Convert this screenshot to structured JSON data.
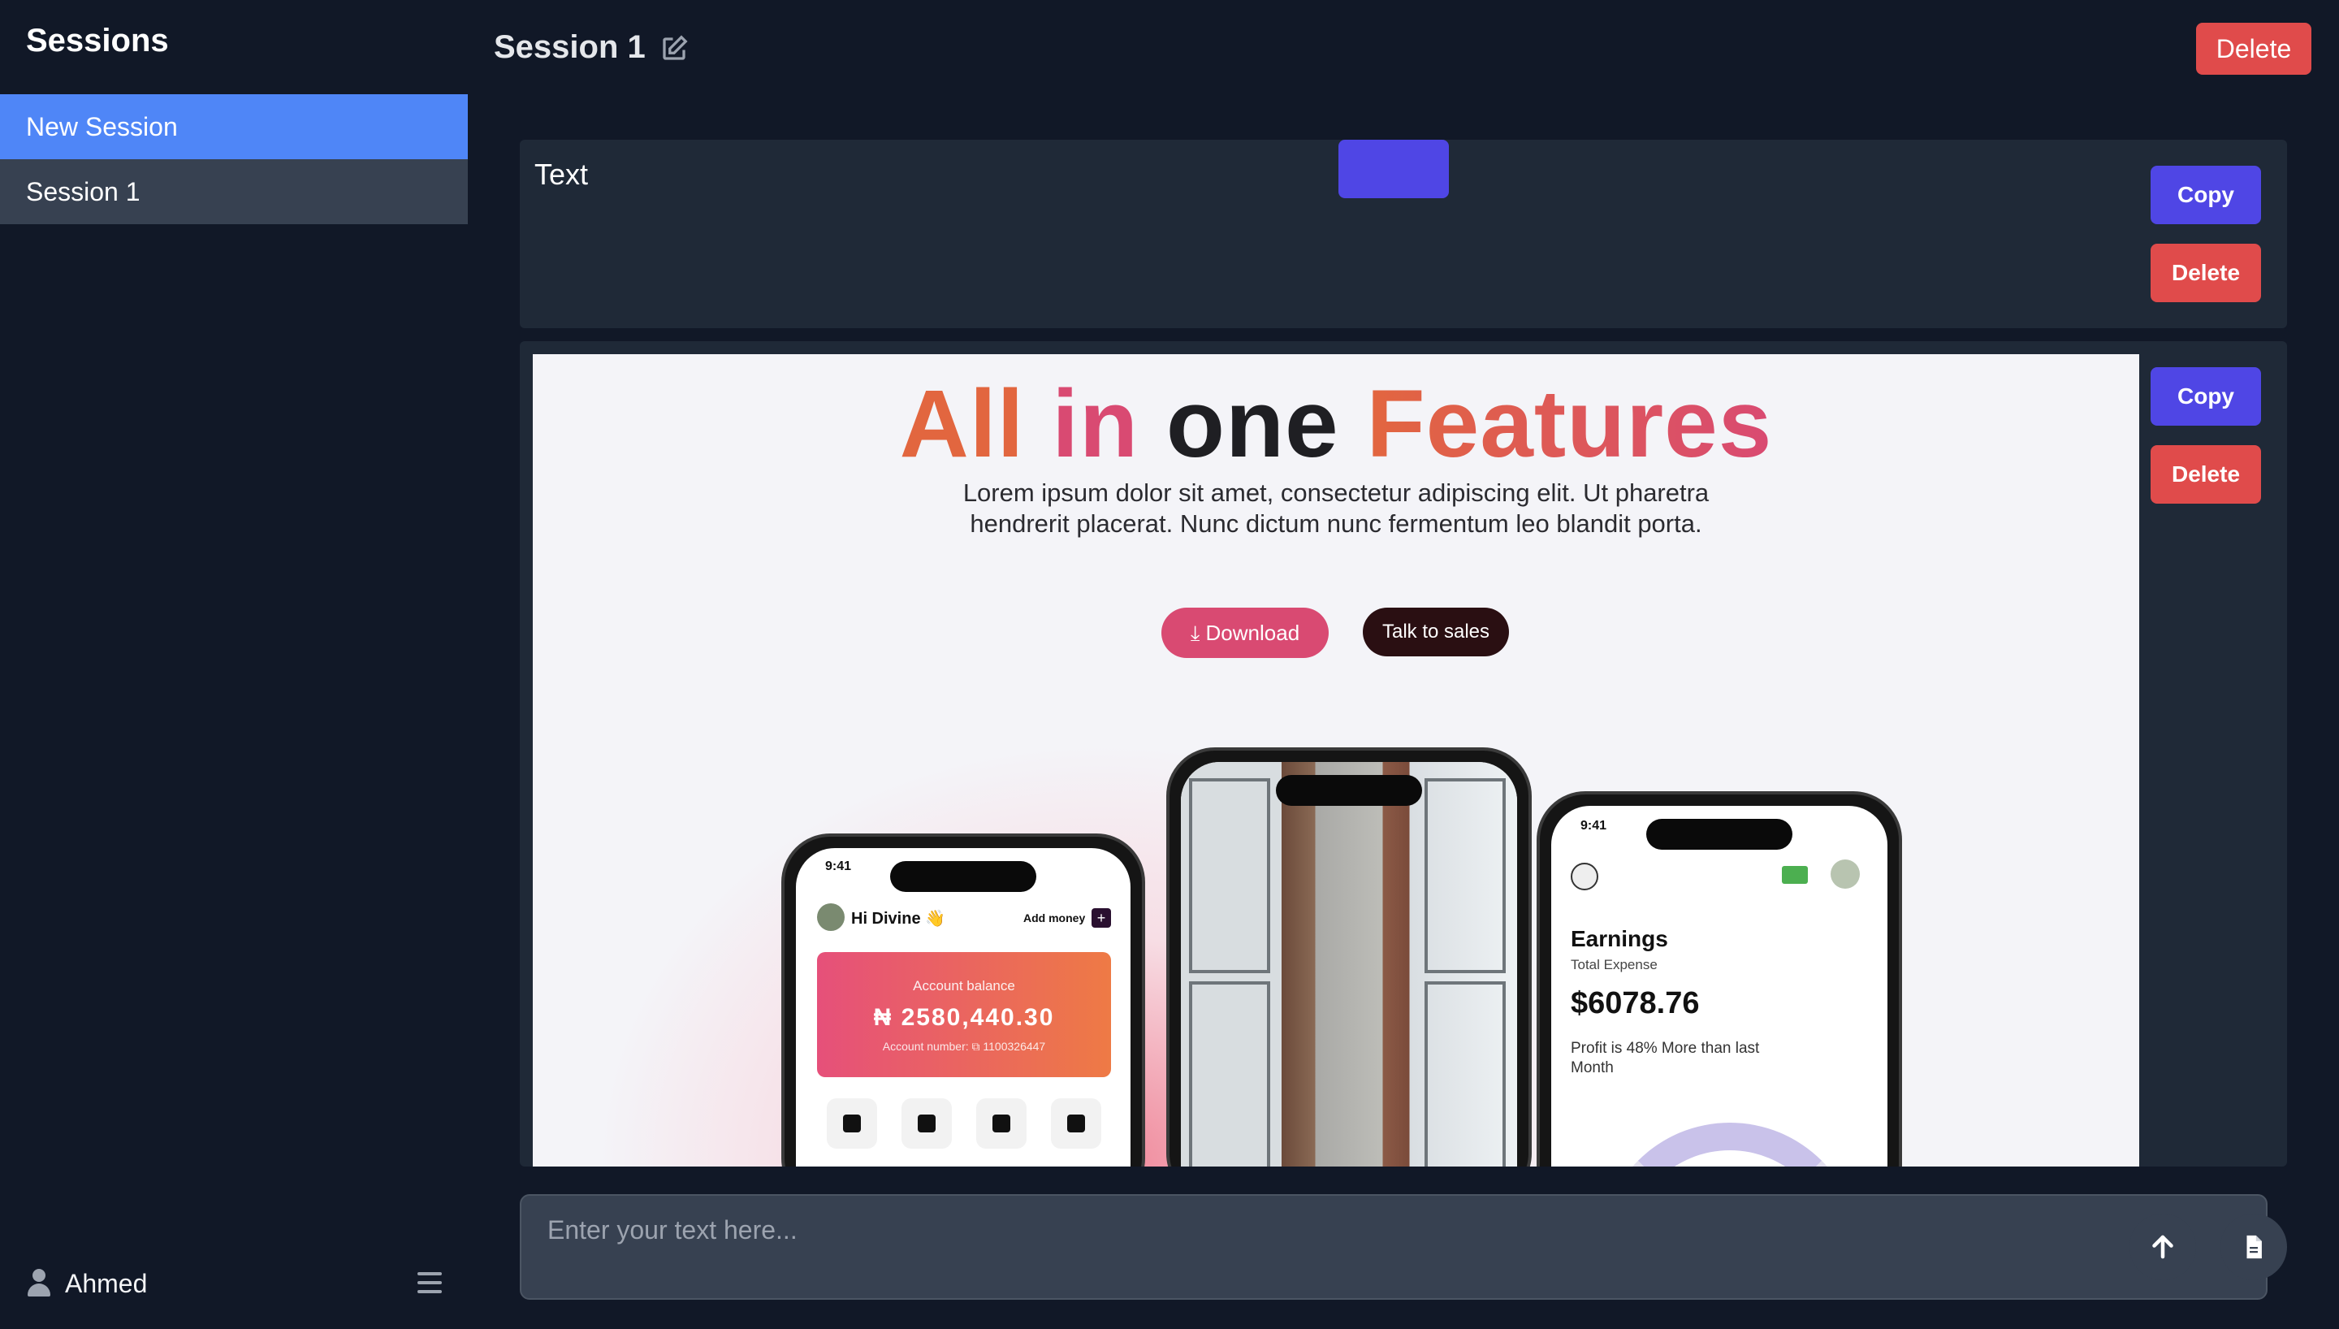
{
  "sidebar": {
    "title": "Sessions",
    "items": [
      {
        "label": "New Session",
        "active": true
      },
      {
        "label": "Session 1",
        "active": false
      }
    ],
    "user": {
      "name": "Ahmed",
      "icon": "user-icon"
    },
    "menu_icon": "hamburger-menu-icon"
  },
  "header": {
    "title": "Session 1",
    "edit_icon": "edit-icon",
    "delete_label": "Delete"
  },
  "messages": [
    {
      "text": "Text",
      "copy_label": "Copy",
      "delete_label": "Delete"
    },
    {
      "type": "image",
      "copy_label": "Copy",
      "delete_label": "Delete"
    }
  ],
  "preview": {
    "title_parts": [
      "All",
      "in",
      "one",
      "Features"
    ],
    "subtitle_lines": [
      "Lorem ipsum dolor sit amet, consectetur adipiscing elit. Ut pharetra",
      "hendrerit placerat. Nunc dictum nunc fermentum leo blandit porta."
    ],
    "download_label": "Download",
    "sales_label": "Talk to sales",
    "phone_left": {
      "time": "9:41",
      "greeting": "Hi Divine 👋",
      "add_money": "Add money",
      "balance_label": "Account balance",
      "balance_value": "₦ 2580,440.30",
      "account_number": "Account number:  ⧉ 1100326447"
    },
    "phone_right": {
      "time": "9:41",
      "title": "Earnings",
      "subtitle": "Total Expense",
      "amount": "$6078.76",
      "note_line1": "Profit is 48% More than last",
      "note_line2": "Month"
    }
  },
  "composer": {
    "placeholder": "Enter your text here...",
    "send_icon": "arrow-up-icon",
    "file_icon": "file-icon"
  },
  "colors": {
    "background": "#111827",
    "active_session": "#4f86f7",
    "panel": "#1f2937",
    "copy_button": "#4f46e5",
    "delete_button": "#e04b4b"
  }
}
